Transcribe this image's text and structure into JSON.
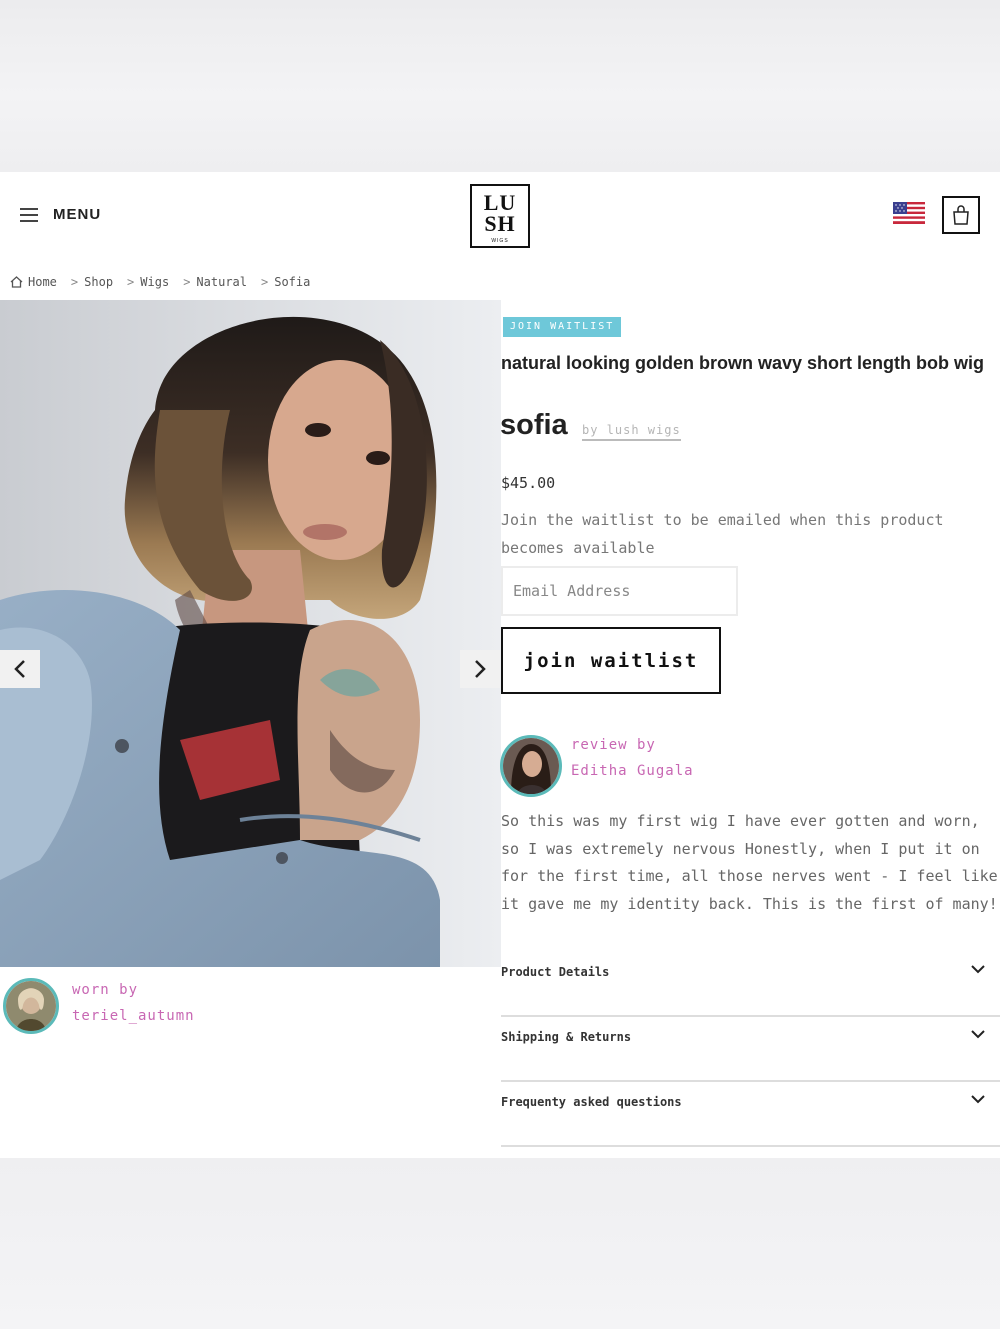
{
  "header": {
    "menu_label": "MENU",
    "logo_line1": "LU",
    "logo_line2": "SH",
    "logo_sub": "WIGS"
  },
  "breadcrumb": [
    "Home",
    "Shop",
    "Wigs",
    "Natural",
    "Sofia"
  ],
  "breadcrumb_separator": ">",
  "product": {
    "badge": "JOIN WAITLIST",
    "subtitle": "natural looking golden brown wavy short length bob wig",
    "name": "sofia",
    "byline": "by lush wigs",
    "price": "$45.00",
    "waitlist_note": "Join the waitlist to be emailed when this product becomes available",
    "email_placeholder": "Email Address",
    "join_button": "join waitlist"
  },
  "worn_by": {
    "label": "worn by",
    "name": "teriel_autumn"
  },
  "review": {
    "label": "review by",
    "name": "Editha Gugala",
    "text": "So this was my first wig I have ever gotten and worn, so I was extremely nervous Honestly, when I put it on for the first time, all those nerves went - I feel like it gave me my identity back. This is the first of many!"
  },
  "accordions": [
    "Product Details",
    "Shipping & Returns",
    "Frequenty asked questions"
  ],
  "colors": {
    "badge": "#6ec8d9",
    "accent_pink": "#c867b3",
    "avatar_ring": "#5bbab9"
  },
  "icons": [
    "hamburger-icon",
    "home-icon",
    "us-flag-icon",
    "shopping-bag-icon",
    "chevron-left-icon",
    "chevron-right-icon",
    "chevron-down-icon"
  ]
}
